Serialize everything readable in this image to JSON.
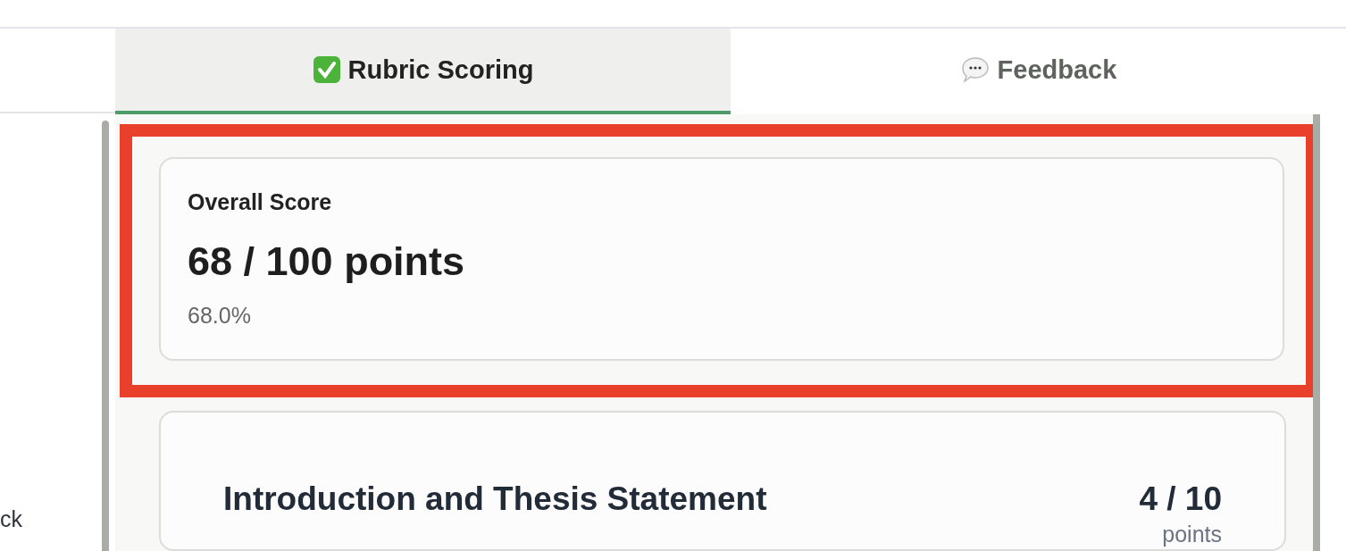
{
  "sidebar": {
    "partial_text": "ck"
  },
  "tabs": [
    {
      "kind": "check",
      "label": "Rubric Scoring",
      "selected": true
    },
    {
      "kind": "speech",
      "label": "Feedback",
      "selected": false
    }
  ],
  "overall": {
    "highlighted": true,
    "label": "Overall Score",
    "score": "68 / 100 points",
    "percent": "68.0%"
  },
  "criteria": [
    {
      "title": "Introduction and Thesis Statement",
      "score": "4 / 10",
      "unit": "points"
    }
  ]
}
